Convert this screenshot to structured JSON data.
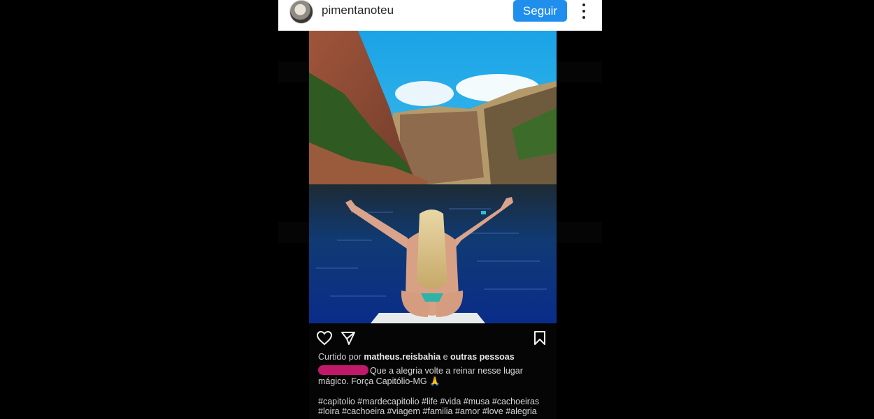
{
  "header": {
    "username": "pimentanoteu",
    "follow_label": "Seguir"
  },
  "post": {
    "liked_by_prefix": "Curtido por",
    "liked_by_user": "matheus.reisbahia",
    "liked_by_conj": " e ",
    "liked_by_others": "outras pessoas",
    "caption": "Que a alegria volte a reinar nesse lugar mágico. Força Capitólio-MG 🙏",
    "hashtags_line1": "#capitolio #mardecapitolio #life #vida #musa #cachoeiras",
    "hashtags_line2": "#loira #cachoeira #viagem #familia #amor #love #alegria"
  },
  "icons": {
    "like": "heart-icon",
    "share": "send-icon",
    "save": "bookmark-icon",
    "menu": "more-vertical-icon"
  },
  "colors": {
    "follow_button": "#1f8eed",
    "redaction": "#c0196a"
  }
}
